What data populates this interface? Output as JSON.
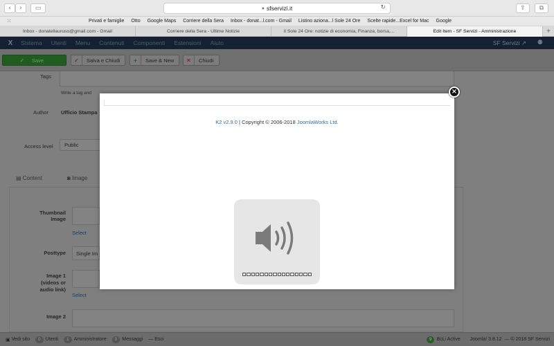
{
  "browser": {
    "url": "sfservizi.it",
    "lock_glyph": "●",
    "reload_glyph": "↻",
    "nav_back": "‹",
    "nav_forward": "›",
    "sidebar_glyph": "▭",
    "share_glyph": "⇪",
    "tabs_glyph": "⧉",
    "grid_glyph": "⁙",
    "favorites": [
      "Privati e famiglie",
      "Otto",
      "Google Maps",
      "Corriere della Sera",
      "Inbox - donat...l.com - Gmail",
      "Listino aziona...l Sole 24 Ore",
      "Scelte rapide...Excel for Mac",
      "Google"
    ],
    "tabs": [
      {
        "label": "Inbox - donatellauruso@gmail.com - Gmail",
        "active": false
      },
      {
        "label": "Corriere della Sera - Ultime Notizie",
        "active": false
      },
      {
        "label": "Il Sole 24 Ore: notizie di economia, Finanza, borsa,...",
        "active": false
      },
      {
        "label": "Edit Item - SF Servizi - Amministrazione",
        "active": true
      }
    ],
    "new_tab": "+"
  },
  "joomla": {
    "logo": "X",
    "menu": [
      "Sistema",
      "Utenti",
      "Menu",
      "Contenuti",
      "Componenti",
      "Estensioni",
      "Aiuto"
    ],
    "site_name": "SF Servizi ↗",
    "user_glyph": "⚉",
    "toolbar": [
      {
        "label": "Save",
        "icon": "✓"
      },
      {
        "label": "Salva e Chiudi",
        "icon": "✓"
      },
      {
        "label": "Save & New",
        "icon": "+"
      },
      {
        "label": "Chiudi",
        "icon": "✕"
      }
    ],
    "form": {
      "tags_label": "Tags",
      "tags_hint": "Write a tag and",
      "author_label": "Author",
      "author_value": "Ufficio Stampa",
      "access_label": "Access level",
      "access_value": "Public",
      "tab_content": "Content",
      "tab_image": "Image",
      "thumbnail_label": "Thumbnail Image",
      "select_1": "Select",
      "posttype_label": "Posttype",
      "posttype_value": "Single Im",
      "image1_label": "Image 1 (videos or audio link)",
      "select_2": "Select",
      "image2_label": "Image 2"
    },
    "footer": [
      {
        "label": "Vedi sito",
        "pill": ""
      },
      {
        "label": "Utenti",
        "pill": "0"
      },
      {
        "label": "Amministratore",
        "pill": "1"
      },
      {
        "label": "Messaggi",
        "pill": "0"
      },
      {
        "label": "Esci",
        "pill": ""
      }
    ],
    "footer_right": {
      "bcli": "BcLi Active",
      "bcli_pill": "9",
      "version": "Joomla! 3.8.12",
      "copyright": "— © 2018 SF Servizi"
    }
  },
  "modal": {
    "version_link": "K2 v2.9.0",
    "copyright_mid": " | Copyright © 2006-2018 ",
    "company_link": "JoomlaWorks Ltd.",
    "close_glyph": "×"
  },
  "volume_hud": {
    "icon": "speaker-icon",
    "level_segments": 16,
    "filled_segments": 0
  }
}
